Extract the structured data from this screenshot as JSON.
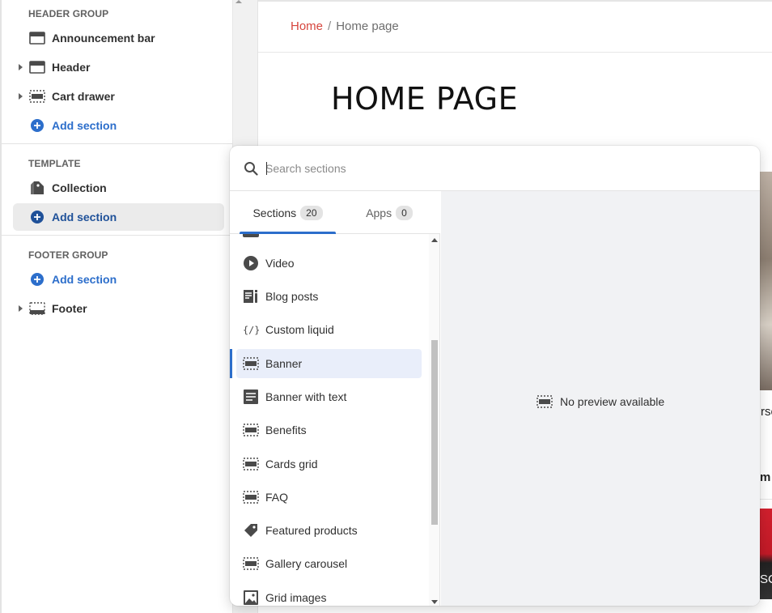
{
  "sidebar": {
    "header_group": {
      "title": "HEADER GROUP",
      "items": [
        {
          "label": "Announcement bar",
          "icon": "section-icon"
        },
        {
          "label": "Header",
          "icon": "section-icon"
        },
        {
          "label": "Cart drawer",
          "icon": "dashed-section-icon"
        }
      ],
      "add_label": "Add section"
    },
    "template": {
      "title": "TEMPLATE",
      "items": [
        {
          "label": "Collection",
          "icon": "collection-icon"
        }
      ],
      "add_label": "Add section"
    },
    "footer_group": {
      "title": "FOOTER GROUP",
      "add_label": "Add section",
      "items": [
        {
          "label": "Footer",
          "icon": "section-icon"
        }
      ]
    }
  },
  "preview": {
    "breadcrumb": {
      "home": "Home",
      "separator": "/",
      "current": "Home page"
    },
    "page_title": "HOME PAGE",
    "peek_text_1": "rse",
    "peek_text_2": "m",
    "peek_text_3": "SC"
  },
  "popover": {
    "search": {
      "placeholder": "Search sections",
      "value": ""
    },
    "tabs": [
      {
        "label": "Sections",
        "count": "20",
        "active": true
      },
      {
        "label": "Apps",
        "count": "0",
        "active": false
      }
    ],
    "sections": [
      {
        "label": "Video",
        "icon": "play-icon"
      },
      {
        "label": "Blog posts",
        "icon": "blog-icon"
      },
      {
        "label": "Custom liquid",
        "icon": "code-icon"
      },
      {
        "label": "Banner",
        "icon": "dashed-section-icon",
        "selected": true
      },
      {
        "label": "Banner with text",
        "icon": "text-block-icon"
      },
      {
        "label": "Benefits",
        "icon": "dashed-section-icon"
      },
      {
        "label": "Cards grid",
        "icon": "dashed-section-icon"
      },
      {
        "label": "FAQ",
        "icon": "dashed-section-icon"
      },
      {
        "label": "Featured products",
        "icon": "tag-icon"
      },
      {
        "label": "Gallery carousel",
        "icon": "dashed-section-icon"
      },
      {
        "label": "Grid images",
        "icon": "image-icon"
      }
    ],
    "no_preview_label": "No preview available"
  },
  "colors": {
    "accent": "#2c6ecb",
    "link_home": "#d6453d",
    "selected_bg": "#e9eefa",
    "preview_bg": "#f1f2f4"
  }
}
